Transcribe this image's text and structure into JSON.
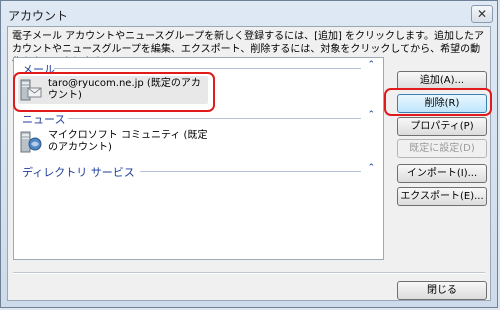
{
  "window": {
    "title": "アカウント",
    "close_glyph": "✕"
  },
  "description": "電子メール アカウントやニュースグループを新しく登録するには、[追加] をクリックします。追加したアカウントやニュースグループを編集、エクスポート、削除するには、対象をクリックしてから、希望の動作をクリックします。",
  "groups": [
    {
      "header": "メール",
      "collapse_glyph": "⌃",
      "accounts": [
        {
          "label": "taro@ryucom.ne.jp (既定のアカウント)",
          "icon": "mail-account-icon",
          "selected": true
        }
      ]
    },
    {
      "header": "ニュース",
      "collapse_glyph": "⌃",
      "accounts": [
        {
          "label": "マイクロソフト コミュニティ (既定のアカウント)",
          "icon": "news-account-icon",
          "selected": false
        }
      ]
    },
    {
      "header": "ディレクトリ サービス",
      "collapse_glyph": "⌃",
      "accounts": []
    }
  ],
  "buttons": {
    "add": "追加(A)...",
    "remove": "削除(R)",
    "properties": "プロパティ(P)",
    "set_default": "既定に設定(D)",
    "import": "インポート(I)...",
    "export": "エクスポート(E)...",
    "close": "閉じる"
  },
  "colors": {
    "highlight_ring": "#e11b1b",
    "group_header": "#1e3e9a"
  }
}
